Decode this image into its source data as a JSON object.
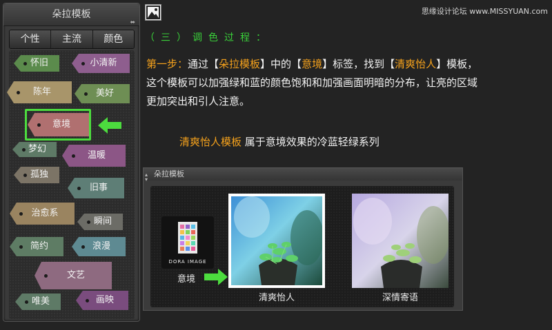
{
  "panel": {
    "title": "朵拉模板",
    "arrows": "⬌",
    "tabs": [
      "个性",
      "主流",
      "颜色"
    ]
  },
  "tags": [
    {
      "label": "怀旧",
      "color": "#5b8b4c"
    },
    {
      "label": "小清新",
      "color": "#8e5e8e"
    },
    {
      "label": "陈年",
      "color": "#a8956a"
    },
    {
      "label": "美好",
      "color": "#6e8e54"
    },
    {
      "label": "意境",
      "color": "#b07070"
    },
    {
      "label": "梦幻",
      "color": "#5e7a66"
    },
    {
      "label": "温暖",
      "color": "#8c5686"
    },
    {
      "label": "孤独",
      "color": "#7c7466"
    },
    {
      "label": "旧事",
      "color": "#5e7e76"
    },
    {
      "label": "治愈系",
      "color": "#9a8460"
    },
    {
      "label": "瞬间",
      "color": "#6c6c66"
    },
    {
      "label": "简约",
      "color": "#5e7c64"
    },
    {
      "label": "浪漫",
      "color": "#5e8a92"
    },
    {
      "label": "文艺",
      "color": "#8e6a80"
    },
    {
      "label": "唯美",
      "color": "#5e7a66"
    },
    {
      "label": "画映",
      "color": "#7a4c7e"
    }
  ],
  "watermark": "思缘设计论坛 www.MISSYUAN.com",
  "section_title": "（三）调色过程：",
  "paragraph": {
    "step": "第一步：",
    "t1": "通过【",
    "h1": "朵拉模板",
    "t2": "】中的【",
    "h2": "意境",
    "t3": "】标签，找到【",
    "h3": "清爽怡人",
    "t4": "】模板，",
    "line2": "这个模板可以加强绿和蓝的颜色饱和和加强画面明暗的分布，让亮的区域",
    "line3": "更加突出和引人注意。"
  },
  "subtitle": {
    "name": "清爽怡人模板",
    "desc": " 属于意境效果的冷蓝轻绿系列"
  },
  "preview": {
    "title": "朵拉模板",
    "logo_text": "DORA IMAGE",
    "logo_label": "意境",
    "thumb1_label": "清爽怡人",
    "thumb2_label": "深情寄语"
  },
  "colors": {
    "accent_green": "#4cdc3e",
    "highlight_orange": "#f4a11c"
  }
}
